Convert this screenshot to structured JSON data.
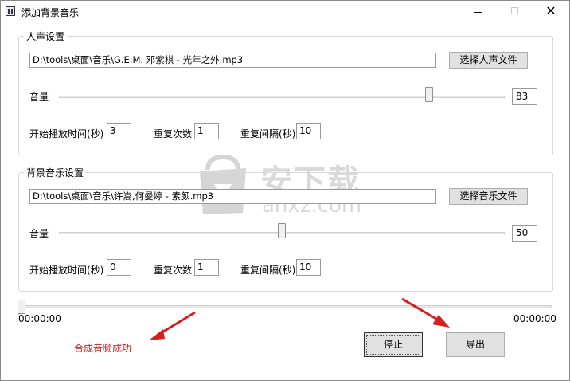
{
  "window": {
    "title": "添加背景音乐"
  },
  "vocal": {
    "group_title": "人声设置",
    "file_path": "D:\\tools\\桌面\\音乐\\G.E.M. 邓紫棋 - 光年之外.mp3",
    "pick_button": "选择人声文件",
    "volume_label": "音量",
    "volume": "83",
    "volume_level": 0.83,
    "start_label": "开始播放时间(秒)",
    "start_value": "3",
    "repeat_label": "重复次数",
    "repeat_value": "1",
    "interval_label": "重复间隔(秒)",
    "interval_value": "10"
  },
  "music": {
    "group_title": "背景音乐设置",
    "file_path": "D:\\tools\\桌面\\音乐\\许嵩,何曼婷 - 素颜.mp3",
    "pick_button": "选择音乐文件",
    "volume_label": "音量",
    "volume": "50",
    "volume_level": 0.5,
    "start_label": "开始播放时间(秒)",
    "start_value": "0",
    "repeat_label": "重复次数",
    "repeat_value": "1",
    "interval_label": "重复间隔(秒)",
    "interval_value": "10"
  },
  "progress": {
    "position": 0,
    "current_time": "00:00:00",
    "total_time": "00:00:00"
  },
  "status": {
    "text": "合成音频成功",
    "color": "#d02020"
  },
  "actions": {
    "stop_label": "停止",
    "export_label": "导出"
  },
  "watermark": {
    "brand": "安下载",
    "url": "anxz.com"
  },
  "colors": {
    "arrow": "#d42020"
  },
  "icons": {
    "app": "app-icon",
    "minimize": "minimize-icon",
    "maximize": "maximize-icon",
    "close": "close-icon"
  }
}
